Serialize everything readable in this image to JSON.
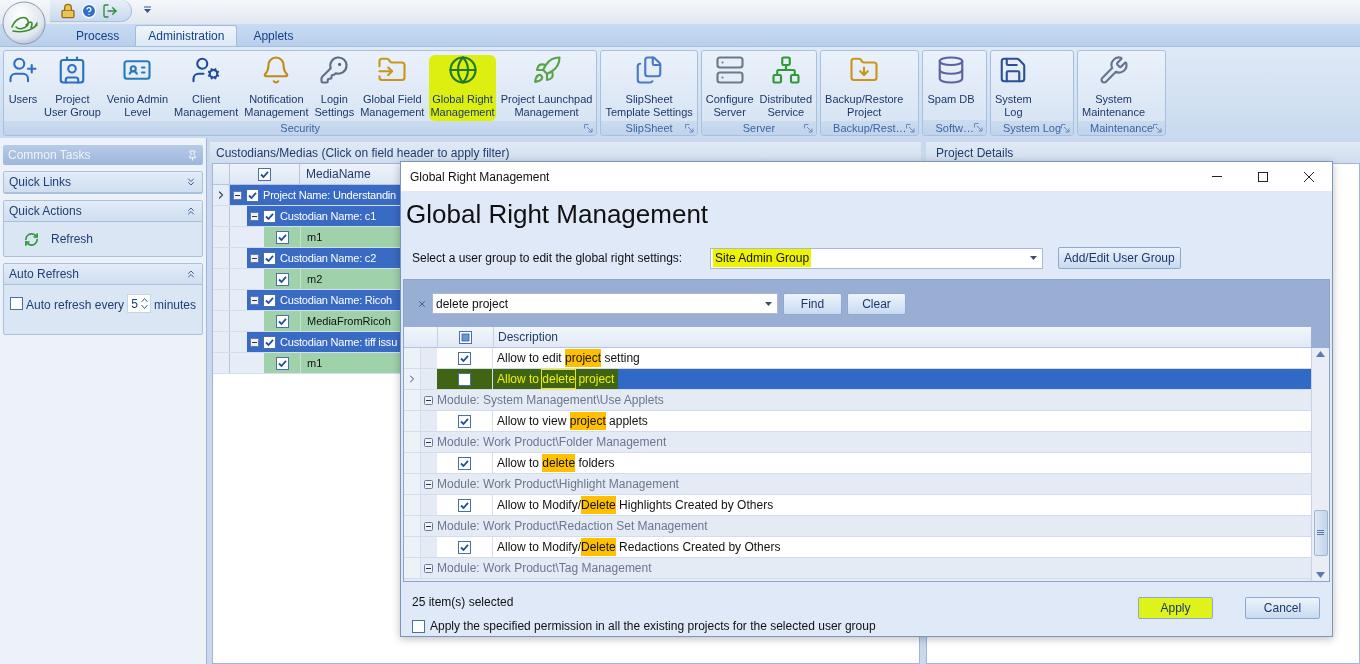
{
  "ribbon": {
    "tabs": [
      {
        "label": "Process",
        "selected": false
      },
      {
        "label": "Administration",
        "selected": true
      },
      {
        "label": "Applets",
        "selected": false
      }
    ],
    "groups": [
      {
        "label": "Security",
        "buttons": [
          {
            "label": "Users",
            "marked": false
          },
          {
            "label": "Project\nUser Group",
            "marked": false
          },
          {
            "label": "Venio Admin\nLevel",
            "marked": false
          },
          {
            "label": "Client\nManagement",
            "marked": false
          },
          {
            "label": "Notification\nManagement",
            "marked": false
          },
          {
            "label": "Login\nSettings",
            "marked": false
          },
          {
            "label": "Global Field\nManagement",
            "marked": false
          },
          {
            "label": "Global Right\nManagement",
            "marked": true
          },
          {
            "label": "Project Launchpad\nManagement",
            "marked": false
          }
        ]
      },
      {
        "label": "SlipSheet",
        "buttons": [
          {
            "label": "SlipSheet\nTemplate Settings",
            "marked": false
          }
        ]
      },
      {
        "label": "Server",
        "buttons": [
          {
            "label": "Configure\nServer",
            "marked": false
          },
          {
            "label": "Distributed\nService",
            "marked": false
          }
        ]
      },
      {
        "label": "Backup/Rest…",
        "buttons": [
          {
            "label": "Backup/Restore\nProject",
            "marked": false
          }
        ]
      },
      {
        "label": "Softw…",
        "buttons": [
          {
            "label": "Spam DB",
            "marked": false
          }
        ]
      },
      {
        "label": "System Log",
        "buttons": [
          {
            "label": "System\nLog",
            "marked": false
          }
        ]
      },
      {
        "label": "Maintenance",
        "buttons": [
          {
            "label": "System\nMaintenance",
            "marked": false
          }
        ]
      }
    ]
  },
  "task_pane": {
    "title": "Common Tasks",
    "sections": [
      {
        "title": "Quick Links",
        "expanded": false
      },
      {
        "title": "Quick Actions",
        "expanded": true,
        "actions": [
          "Refresh"
        ]
      },
      {
        "title": "Auto Refresh",
        "expanded": true,
        "auto_refresh": {
          "checked": false,
          "label": "Auto refresh every",
          "value": "5",
          "unit": "minutes"
        }
      }
    ]
  },
  "custodians_pane": {
    "title": "Custodians/Medias (Click on field header to apply filter)",
    "check_all": {
      "checked": true
    },
    "columns": [
      "MediaName"
    ],
    "rows": [
      {
        "kind": "project",
        "label": "Project Name: Understandin",
        "checked": true,
        "expanded": true,
        "current": true,
        "children": [
          {
            "kind": "custodian",
            "label": "Custodian Name: c1",
            "checked": true,
            "expanded": true,
            "current": false,
            "children": [
              {
                "kind": "media",
                "label": "m1",
                "checked": true,
                "current": false
              }
            ]
          },
          {
            "kind": "custodian",
            "label": "Custodian Name: c2",
            "checked": true,
            "expanded": true,
            "current": false,
            "children": [
              {
                "kind": "media",
                "label": "m2",
                "checked": true,
                "current": false
              }
            ]
          },
          {
            "kind": "custodian",
            "label": "Custodian Name: Ricoh",
            "checked": true,
            "expanded": true,
            "current": false,
            "children": [
              {
                "kind": "media",
                "label": "MediaFromRicoh",
                "checked": true,
                "current": false
              }
            ]
          },
          {
            "kind": "custodian",
            "label": "Custodian Name: tiff issu",
            "checked": true,
            "expanded": true,
            "current": false,
            "children": [
              {
                "kind": "media",
                "label": "m1",
                "checked": true,
                "current": false
              }
            ]
          }
        ]
      }
    ]
  },
  "details_pane": {
    "title": "Project Details"
  },
  "dialog": {
    "title": "Global Right Management",
    "heading": "Global Right Management",
    "user_group": {
      "label": "Select a user group to edit the global right settings:",
      "value": "Site Admin Group",
      "marked": true
    },
    "add_edit_button": "Add/Edit User Group",
    "search": {
      "value": "delete project",
      "find": "Find",
      "clear": "Clear"
    },
    "grid": {
      "check_all": {
        "indeterminate": true
      },
      "columns": [
        "Description"
      ],
      "rows": [
        {
          "kind": "permission",
          "checked": true,
          "selected": false,
          "marked": false,
          "segments": [
            {
              "text": "Allow to edit ",
              "match": false
            },
            {
              "text": "project",
              "match": true
            },
            {
              "text": " setting",
              "match": false
            }
          ]
        },
        {
          "kind": "permission",
          "checked": false,
          "selected": true,
          "marked": true,
          "segments": [
            {
              "text": "Allow to ",
              "match": false
            },
            {
              "text": "delete",
              "match": true
            },
            {
              "text": " project",
              "match": false
            }
          ]
        },
        {
          "kind": "module",
          "label": "Module: System Management\\Use Applets",
          "expanded": true,
          "children": [
            {
              "kind": "permission",
              "checked": true,
              "selected": false,
              "marked": false,
              "segments": [
                {
                  "text": "Allow to view ",
                  "match": false
                },
                {
                  "text": "project",
                  "match": true
                },
                {
                  "text": " applets",
                  "match": false
                }
              ]
            }
          ]
        },
        {
          "kind": "module",
          "label": "Module: Work Product\\Folder Management",
          "expanded": true,
          "children": [
            {
              "kind": "permission",
              "checked": true,
              "selected": false,
              "marked": false,
              "segments": [
                {
                  "text": "Allow to ",
                  "match": false
                },
                {
                  "text": "delete",
                  "match": true
                },
                {
                  "text": " folders",
                  "match": false
                }
              ]
            }
          ]
        },
        {
          "kind": "module",
          "label": "Module: Work Product\\Highlight Management",
          "expanded": true,
          "children": [
            {
              "kind": "permission",
              "checked": true,
              "selected": false,
              "marked": false,
              "segments": [
                {
                  "text": "Allow to Modify/",
                  "match": false
                },
                {
                  "text": "Delete",
                  "match": true
                },
                {
                  "text": " Highlights Created by Others",
                  "match": false
                }
              ]
            }
          ]
        },
        {
          "kind": "module",
          "label": "Module: Work Product\\Redaction Set Management",
          "expanded": true,
          "children": [
            {
              "kind": "permission",
              "checked": true,
              "selected": false,
              "marked": false,
              "segments": [
                {
                  "text": "Allow to Modify/",
                  "match": false
                },
                {
                  "text": "Delete",
                  "match": true
                },
                {
                  "text": " Redactions Created by Others",
                  "match": false
                }
              ]
            }
          ]
        },
        {
          "kind": "module",
          "label": "Module: Work Product\\Tag Management",
          "expanded": true
        }
      ]
    },
    "footer": {
      "status": "25 item(s) selected",
      "apply_all": {
        "label": "Apply the specified permission in all the existing projects for the selected user group",
        "checked": false
      }
    },
    "buttons": [
      {
        "label": "Apply",
        "marked": true
      },
      {
        "label": "Cancel",
        "marked": false
      }
    ]
  }
}
